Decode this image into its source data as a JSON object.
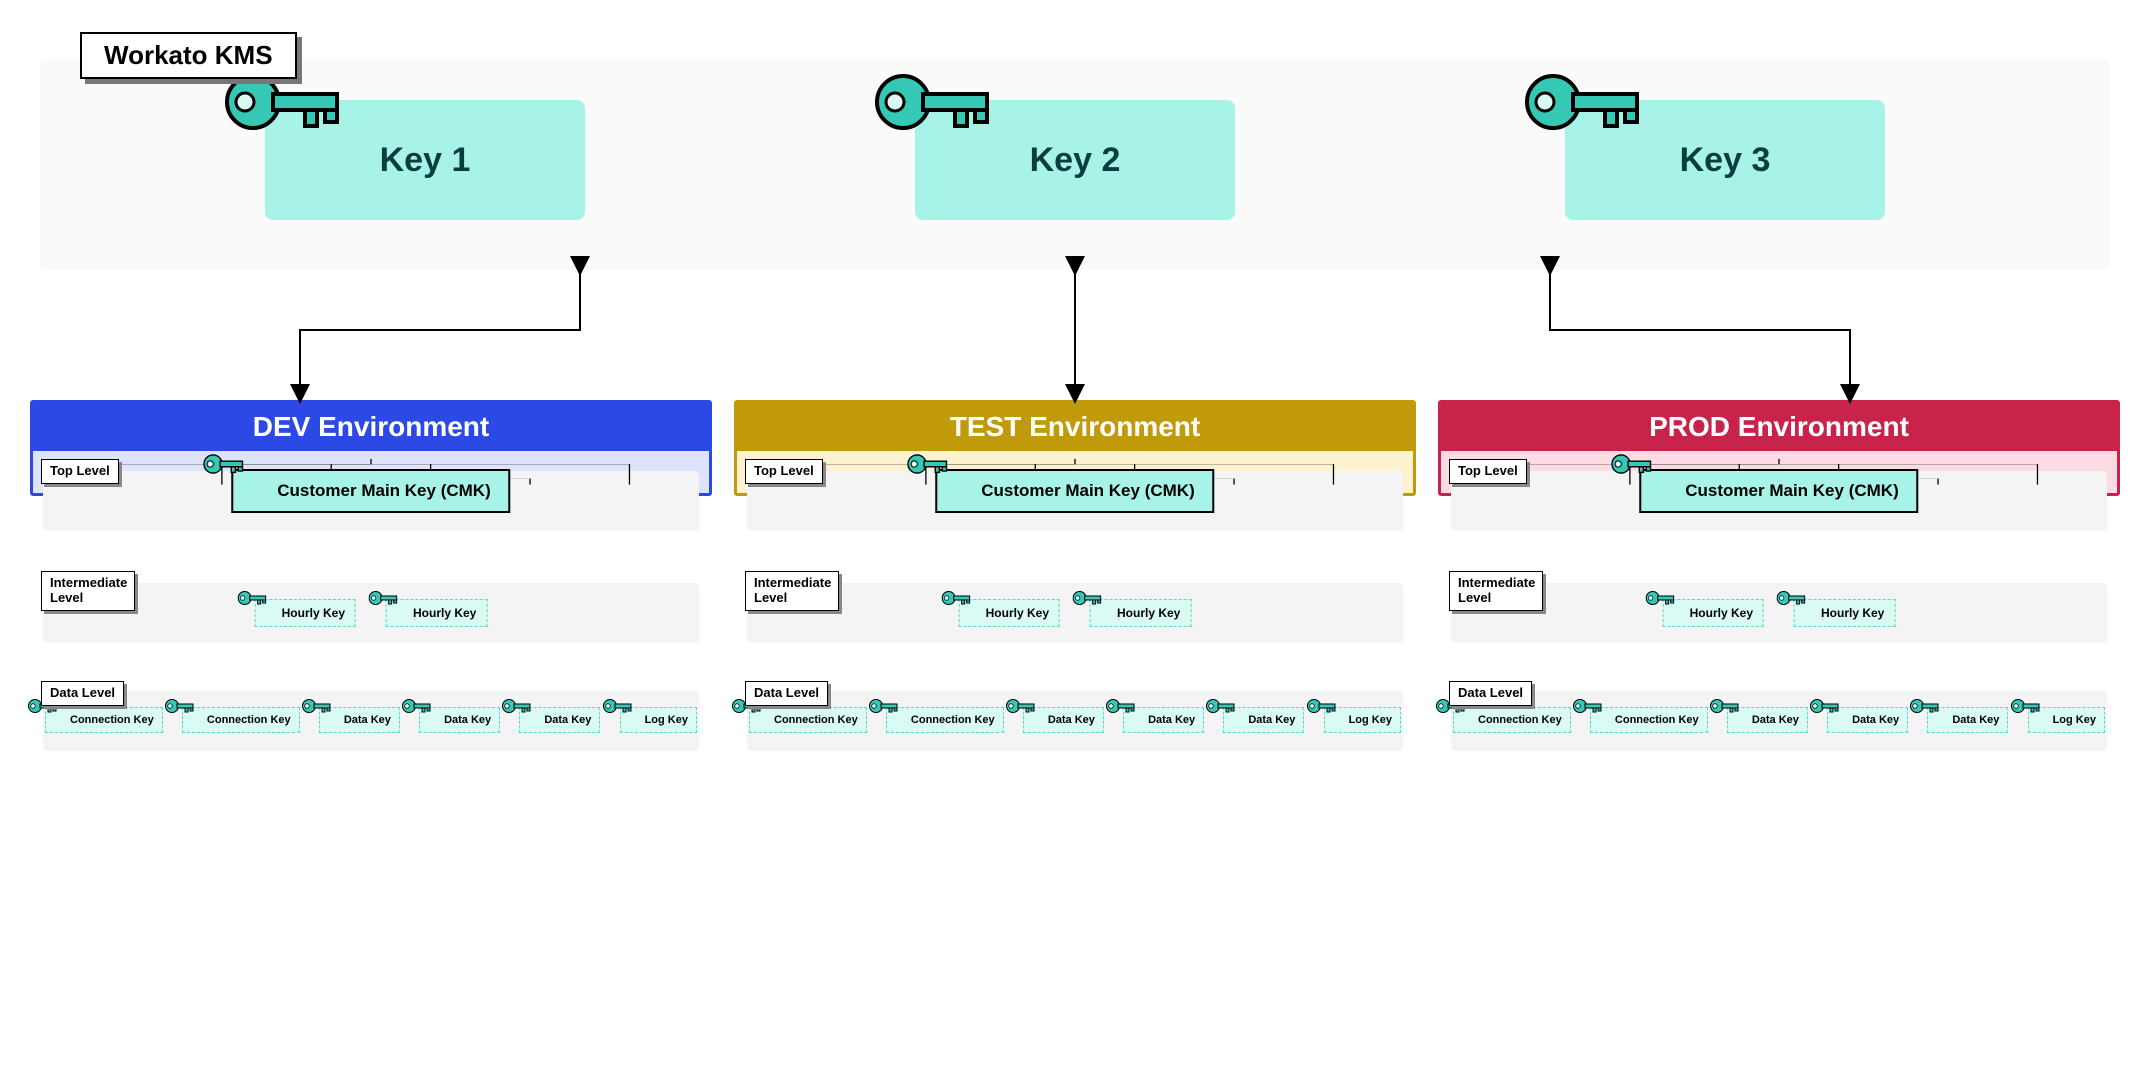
{
  "kms": {
    "title": "Workato KMS",
    "keys": [
      {
        "label": "Key 1"
      },
      {
        "label": "Key 2"
      },
      {
        "label": "Key 3"
      }
    ]
  },
  "environments": [
    {
      "variant": "dev",
      "title": "DEV Environment",
      "levels": {
        "top": "Top Level",
        "mid": "Intermediate Level",
        "data": "Data Level"
      },
      "cmk": "Customer Main Key (CMK)",
      "hourly": [
        "Hourly Key",
        "Hourly Key"
      ],
      "data_keys": [
        "Connection Key",
        "Connection Key",
        "Data Key",
        "Data Key",
        "Data Key",
        "Log Key"
      ]
    },
    {
      "variant": "test",
      "title": "TEST Environment",
      "levels": {
        "top": "Top Level",
        "mid": "Intermediate Level",
        "data": "Data Level"
      },
      "cmk": "Customer Main Key (CMK)",
      "hourly": [
        "Hourly Key",
        "Hourly Key"
      ],
      "data_keys": [
        "Connection Key",
        "Connection Key",
        "Data Key",
        "Data Key",
        "Data Key",
        "Log Key"
      ]
    },
    {
      "variant": "prod",
      "title": "PROD Environment",
      "levels": {
        "top": "Top Level",
        "mid": "Intermediate Level",
        "data": "Data Level"
      },
      "cmk": "Customer Main Key (CMK)",
      "hourly": [
        "Hourly Key",
        "Hourly Key"
      ],
      "data_keys": [
        "Connection Key",
        "Connection Key",
        "Data Key",
        "Data Key",
        "Data Key",
        "Log Key"
      ]
    }
  ],
  "colors": {
    "teal": "#34c8b5",
    "teal_light": "#a7f3e8",
    "dev": "#2d49e5",
    "test": "#c09a0a",
    "prod": "#c8234a"
  }
}
